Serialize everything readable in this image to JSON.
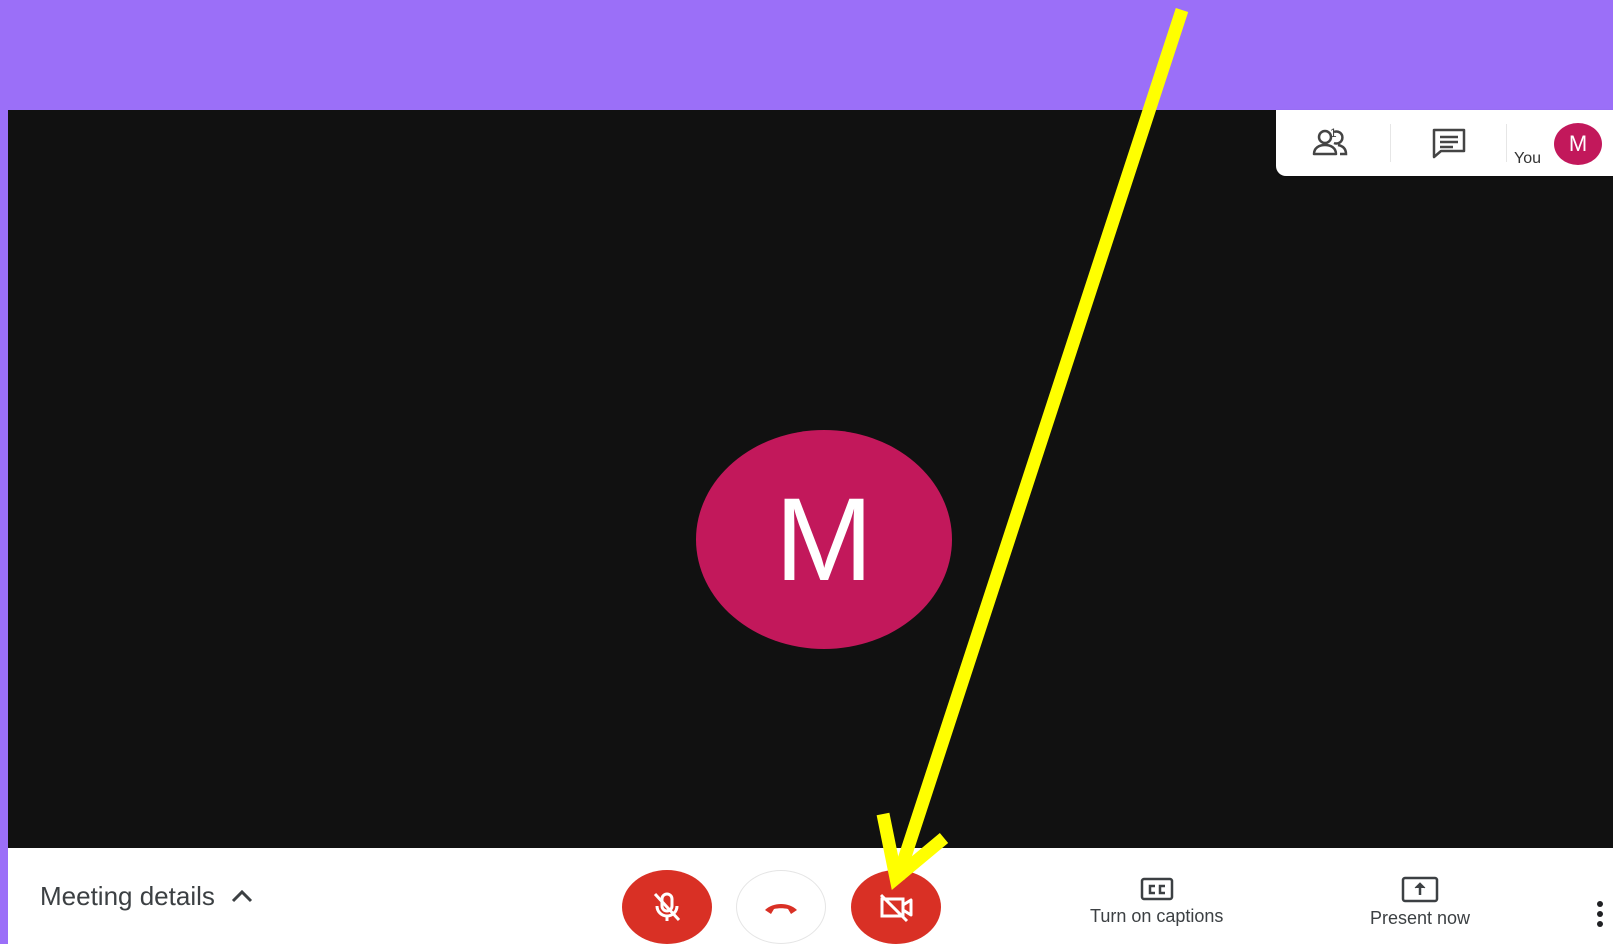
{
  "top_panel": {
    "participants_count": "1",
    "you_label": "You",
    "user_initial": "M"
  },
  "main": {
    "avatar_initial": "M"
  },
  "bottom_bar": {
    "meeting_details_label": "Meeting details",
    "captions_label": "Turn on captions",
    "present_label": "Present now"
  },
  "colors": {
    "page_background": "#9b6ff8",
    "stage_background": "#111111",
    "avatar": "#c2185b",
    "danger": "#d93025",
    "annotation_arrow": "#ffff00"
  },
  "icons": {
    "participants": "people-icon",
    "chat": "chat-icon",
    "mic_off": "mic-off-icon",
    "hang_up": "phone-hangup-icon",
    "camera_off": "camera-off-icon",
    "captions": "closed-captions-icon",
    "present": "present-screen-icon",
    "more": "more-vertical-icon",
    "details_toggle": "chevron-up-icon"
  }
}
